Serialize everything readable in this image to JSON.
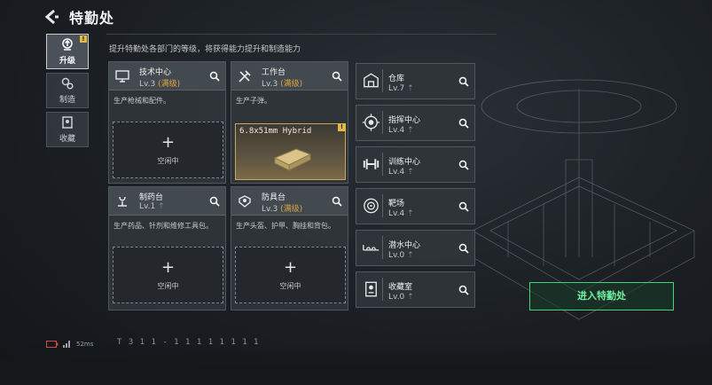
{
  "header": {
    "title": "特勤处"
  },
  "sidebar": {
    "tabs": [
      {
        "label": "升级",
        "badge": "!"
      },
      {
        "label": "制造"
      },
      {
        "label": "收藏"
      }
    ]
  },
  "subtitle": "提升特勤处各部门的等级，将获得能力提升和制造能力",
  "cards": {
    "tech": {
      "name": "技术中心",
      "level": "Lv.3",
      "max": "(满级)",
      "desc": "生产枪械和配件。",
      "slot": "空闲中"
    },
    "workbench": {
      "name": "工作台",
      "level": "Lv.3",
      "max": "(满级)",
      "desc": "生产子弹。",
      "product": "6.8x51mm Hybrid",
      "badge": "!"
    },
    "pharmacy": {
      "name": "制药台",
      "level": "Lv.1",
      "desc": "生产药品、针剂和维修工具包。",
      "slot": "空闲中"
    },
    "armor": {
      "name": "防具台",
      "level": "Lv.3",
      "max": "(满级)",
      "desc": "生产头盔、护甲、胸挂和背包。",
      "slot": "空闲中"
    }
  },
  "right_list": [
    {
      "name": "仓库",
      "level": "Lv.7",
      "icon": "warehouse-icon"
    },
    {
      "name": "指挥中心",
      "level": "Lv.4",
      "icon": "command-center-icon"
    },
    {
      "name": "训练中心",
      "level": "Lv.4",
      "icon": "dumbbell-icon"
    },
    {
      "name": "靶场",
      "level": "Lv.4",
      "icon": "target-icon"
    },
    {
      "name": "潜水中心",
      "level": "Lv.0",
      "icon": "diving-icon"
    },
    {
      "name": "收藏室",
      "level": "Lv.0",
      "icon": "collection-room-icon"
    }
  ],
  "enter_button": "进入特勤处",
  "status": {
    "ping": "52ms",
    "uid": "T 3 1 1 - 1 1 1 1 1 1 1 1"
  },
  "colors": {
    "accent_green": "#3bd67a",
    "max_level": "#d9a441",
    "badge": "#e2b84a"
  }
}
